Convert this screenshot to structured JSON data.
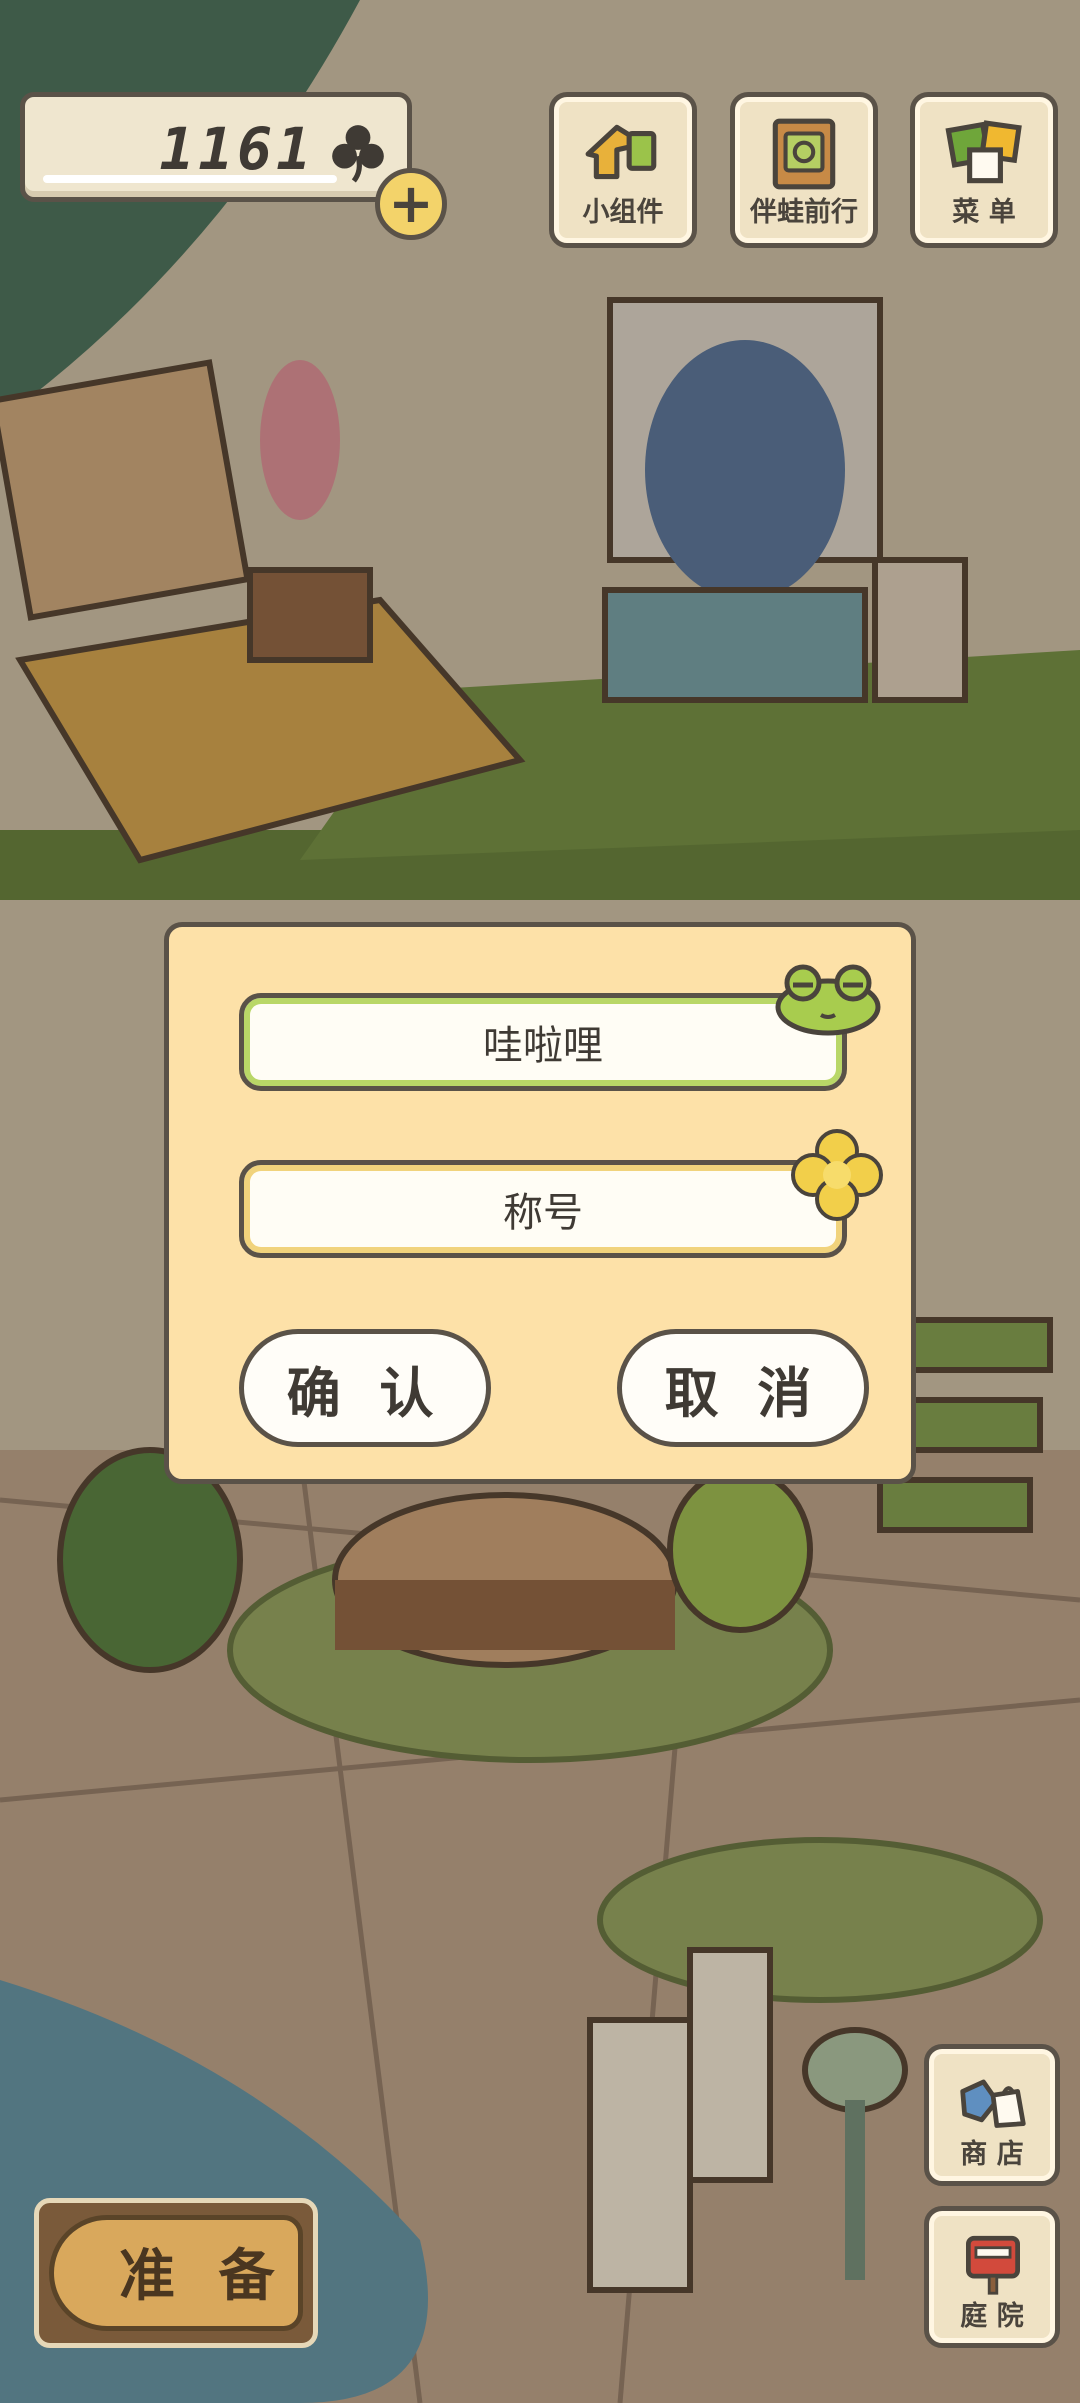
{
  "topbar": {
    "clover_count": "1161",
    "buttons": [
      {
        "label": "小组件",
        "icon": "widget-house-icon"
      },
      {
        "label": "伴蛙前行",
        "icon": "photo-album-icon"
      },
      {
        "label": "菜 单",
        "icon": "menu-cards-icon"
      }
    ]
  },
  "dialog": {
    "name_value": "哇啦哩",
    "title_placeholder": "称号",
    "confirm_label": "确 认",
    "cancel_label": "取 消"
  },
  "bottom": {
    "ready_label": "准 备",
    "shop_label": "商 店",
    "yard_label": "庭 院"
  },
  "colors": {
    "dialog_bg": "#fde1a8",
    "outline": "#5a5248",
    "name_field_ring": "#b9d767",
    "title_field_ring": "#f1d37c"
  }
}
